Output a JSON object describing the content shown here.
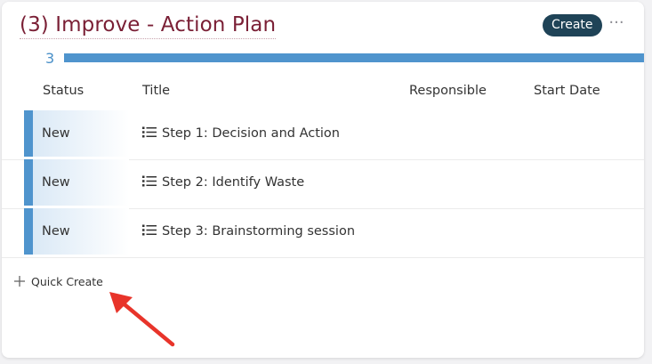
{
  "panel": {
    "title": "(3) Improve - Action Plan",
    "create_label": "Create",
    "more_label": "···"
  },
  "group": {
    "count": "3",
    "fill_fraction": 1.0,
    "color": "#4f94cd"
  },
  "table": {
    "columns": [
      "Status",
      "Title",
      "Responsible",
      "Start Date"
    ],
    "rows": [
      {
        "status": "New",
        "title": "Step 1: Decision and Action"
      },
      {
        "status": "New",
        "title": "Step 2: Identify Waste"
      },
      {
        "status": "New",
        "title": "Step 3: Brainstorming session"
      }
    ]
  },
  "quick_create": {
    "label": "Quick Create",
    "icon": "plus-icon"
  },
  "annotation": {
    "icon": "red-arrow-icon",
    "color": "#e8342a"
  },
  "colors": {
    "title": "#7a1f35",
    "button": "#1f4357",
    "status_accent": "#4f94cd"
  }
}
